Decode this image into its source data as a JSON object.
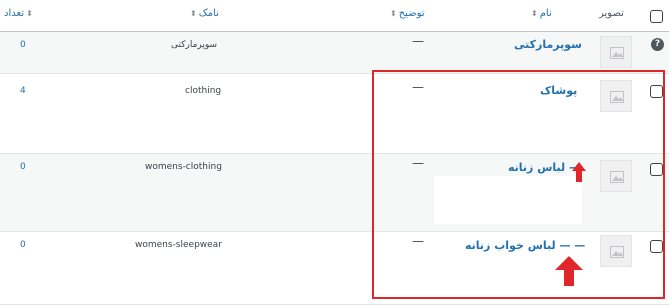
{
  "columns": {
    "count": "تعداد",
    "slug": "نامک",
    "description": "توضیح",
    "name": "نام",
    "image": "تصویر"
  },
  "rows": [
    {
      "name": "سوپرمارکتی",
      "description": "—",
      "slug": "سوپرمارکتی",
      "count": "0"
    },
    {
      "name": "پوشاک",
      "description": "—",
      "slug": "clothing",
      "count": "4"
    },
    {
      "name": "— لباس زنانه",
      "description": "—",
      "slug": "womens-clothing",
      "count": "0"
    },
    {
      "name": "— — لباس خواب زنانه",
      "description": "—",
      "slug": "womens-sleepwear",
      "count": "0"
    }
  ],
  "help_icon": "?",
  "annotation": {
    "highlight_color": "#e0252b"
  },
  "icons": {
    "thumbnail": "image-placeholder-icon",
    "sort": "sort-arrows-icon",
    "help": "question-icon"
  }
}
